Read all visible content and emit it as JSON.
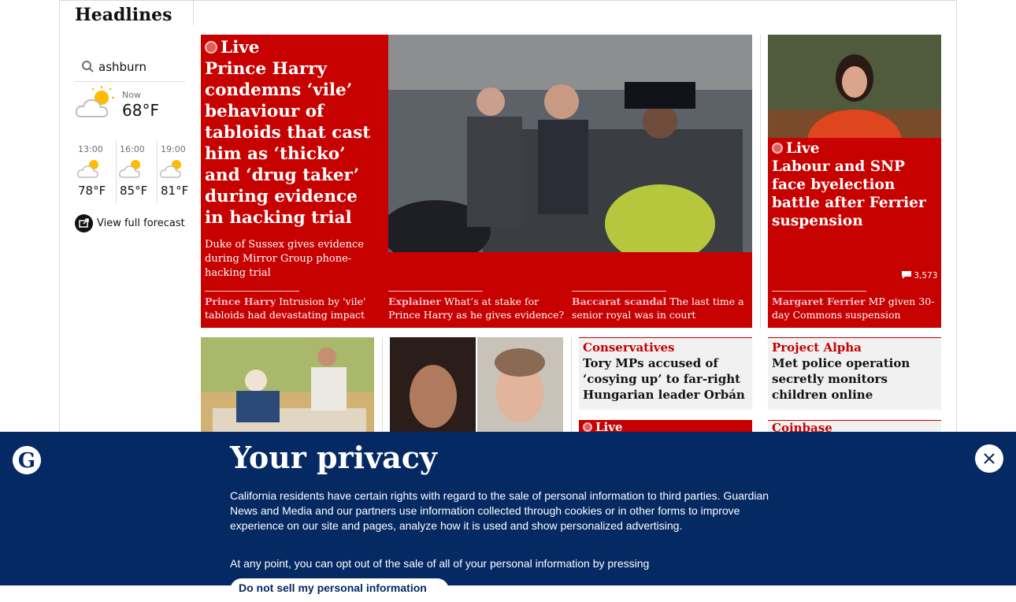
{
  "section": {
    "title": "Headlines"
  },
  "weather": {
    "location": "ashburn",
    "now_label": "Now",
    "now_temp": "68°F",
    "forecast": [
      {
        "time": "13:00",
        "temp": "78°F",
        "icon": "partly-cloudy-icon"
      },
      {
        "time": "16:00",
        "temp": "85°F",
        "icon": "partly-cloudy-icon"
      },
      {
        "time": "19:00",
        "temp": "81°F",
        "icon": "partly-cloudy-icon"
      }
    ],
    "full_forecast_label": "View full forecast"
  },
  "main_story": {
    "live_label": "Live",
    "headline": "Prince Harry condemns ‘vile’ behaviour of tabloids that cast him as ‘thicko’ and ‘drug taker’ during evidence in hacking trial",
    "standfirst": "Duke of Sussex gives evidence during Mirror Group phone-hacking trial",
    "related": [
      {
        "kicker": "Prince Harry",
        "text": "Intrusion by 'vile' tabloids had devastating impact"
      },
      {
        "kicker": "Explainer",
        "text": "What’s at stake for Prince Harry as he gives evidence?"
      },
      {
        "kicker": "Baccarat scandal",
        "text": "The last time a senior royal was in court"
      }
    ]
  },
  "side_story": {
    "live_label": "Live",
    "headline": "Labour and SNP face byelection battle after Ferrier suspension",
    "comment_count": "3,573",
    "related": {
      "kicker": "Margaret Ferrier",
      "text": "MP given 30-day Commons suspension"
    }
  },
  "small_cards": [
    {
      "kicker": "Conservatives",
      "headline": "Tory MPs accused of ‘cosying up’ to far-right Hungarian leader Orbán"
    },
    {
      "kicker": "Project Alpha",
      "headline": "Met police operation secretly monitors children online"
    },
    {
      "live_label": "Live"
    },
    {
      "kicker": "Coinbase"
    }
  ],
  "consent": {
    "title": "Your privacy",
    "body": "California residents have certain rights with regard to the sale of personal information to third parties. Guardian News and Media and our partners use information collected through cookies or in other forms to improve experience on our site and pages, analyze how it is used and show personalized advertising.",
    "body2": "At any point, you can opt out of the sale of all of your personal information by pressing",
    "button_label": "Do not sell my personal information",
    "close_icon": "close-icon"
  },
  "colors": {
    "news_red": "#c70000",
    "brand_blue": "#052962",
    "kicker_red": "#c70000"
  }
}
